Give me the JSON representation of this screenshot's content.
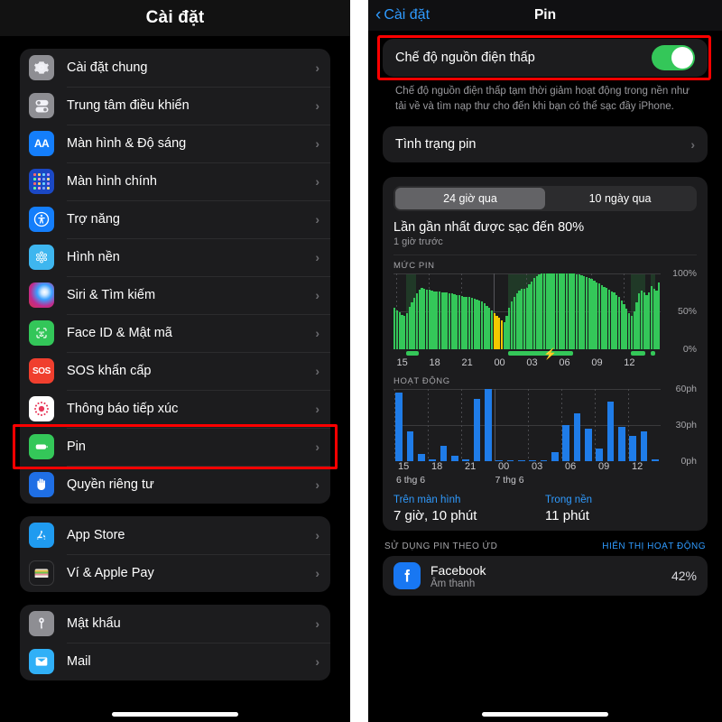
{
  "left": {
    "title": "Cài đặt",
    "groups": [
      {
        "items": [
          {
            "label": "Cài đặt chung",
            "icon": "gear-icon"
          },
          {
            "label": "Trung tâm điều khiển",
            "icon": "control-center-icon"
          },
          {
            "label": "Màn hình & Độ sáng",
            "icon": "display-brightness-icon"
          },
          {
            "label": "Màn hình chính",
            "icon": "home-screen-icon"
          },
          {
            "label": "Trợ năng",
            "icon": "accessibility-icon"
          },
          {
            "label": "Hình nền",
            "icon": "wallpaper-icon"
          },
          {
            "label": "Siri & Tìm kiếm",
            "icon": "siri-icon"
          },
          {
            "label": "Face ID & Mật mã",
            "icon": "face-id-icon"
          },
          {
            "label": "SOS khẩn cấp",
            "icon": "sos-icon"
          },
          {
            "label": "Thông báo tiếp xúc",
            "icon": "exposure-notification-icon"
          },
          {
            "label": "Pin",
            "icon": "battery-icon",
            "highlighted": true
          },
          {
            "label": "Quyền riêng tư",
            "icon": "privacy-hand-icon"
          }
        ]
      },
      {
        "items": [
          {
            "label": "App Store",
            "icon": "app-store-icon"
          },
          {
            "label": "Ví & Apple Pay",
            "icon": "wallet-icon"
          }
        ]
      },
      {
        "items": [
          {
            "label": "Mật khẩu",
            "icon": "key-icon"
          },
          {
            "label": "Mail",
            "icon": "mail-icon"
          }
        ]
      }
    ],
    "chevron": "›"
  },
  "right": {
    "back_label": "Cài đặt",
    "back_chevron": "‹",
    "title": "Pin",
    "low_power": {
      "label": "Chế độ nguồn điện thấp",
      "enabled": true,
      "footnote": "Chế độ nguồn điện thấp tạm thời giảm hoạt động trong nền như tải về và tìm nạp thư cho đến khi bạn có thể sạc đầy iPhone."
    },
    "battery_health": {
      "label": "Tình trạng pin",
      "chevron": "›"
    },
    "segmented": {
      "options": [
        "24 giờ qua",
        "10 ngày qua"
      ],
      "selected_index": 0
    },
    "last_charge": {
      "title": "Lần gần nhất được sạc đến 80%",
      "subtitle": "1 giờ trước"
    },
    "stats": [
      {
        "key": "Trên màn hình",
        "value": "7 giờ, 10 phút"
      },
      {
        "key": "Trong nền",
        "value": "11 phút"
      }
    ],
    "usage_section": {
      "left": "SỬ DỤNG PIN THEO ỨD",
      "right": "HIỂN THỊ HOẠT ĐỘNG"
    },
    "apps": [
      {
        "name": "Facebook",
        "sub": "Âm thanh",
        "pct": "42%",
        "icon": "facebook-icon",
        "color": "#1877f2"
      }
    ],
    "colors": {
      "accent_blue": "#2f9bff",
      "battery_green": "#34c759",
      "low_power_yellow": "#f5c800",
      "activity_blue": "#1f7ce8",
      "highlight_red": "#ff0000"
    }
  },
  "chart_data": [
    {
      "type": "bar",
      "title": "MỨC PIN",
      "xlabel": "",
      "ylabel": "",
      "ylim": [
        0,
        100
      ],
      "yticks": [
        0,
        50,
        100
      ],
      "ytick_labels": [
        "0%",
        "50%",
        "100%"
      ],
      "xticks": [
        "15",
        "18",
        "21",
        "00",
        "03",
        "06",
        "09",
        "12"
      ],
      "grid": true,
      "series_color": "#34c759",
      "lowpower_color": "#f5c800",
      "values": [
        55,
        52,
        49,
        46,
        44,
        48,
        56,
        62,
        68,
        74,
        79,
        81,
        80,
        79,
        79,
        78,
        77,
        77,
        77,
        76,
        76,
        75,
        74,
        74,
        73,
        72,
        72,
        71,
        70,
        70,
        69,
        68,
        67,
        66,
        65,
        63,
        61,
        58,
        55,
        52,
        48,
        45,
        42,
        39,
        36,
        45,
        55,
        63,
        70,
        74,
        78,
        80,
        80,
        81,
        86,
        90,
        94,
        97,
        99,
        100,
        100,
        100,
        100,
        100,
        100,
        100,
        100,
        100,
        100,
        100,
        100,
        100,
        100,
        99,
        99,
        98,
        97,
        96,
        95,
        93,
        91,
        89,
        87,
        85,
        83,
        81,
        79,
        77,
        75,
        72,
        69,
        65,
        60,
        54,
        48,
        44,
        50,
        62,
        74,
        78,
        75,
        72,
        76,
        84,
        80,
        78,
        88
      ],
      "lowpower_bar_indices": [
        40,
        41,
        42,
        43
      ],
      "charging_shaded_ranges": [
        [
          5,
          9
        ],
        [
          46,
          64
        ],
        [
          95,
          101
        ],
        [
          103,
          105
        ]
      ],
      "charging_segments": [
        [
          5,
          10
        ],
        [
          46,
          72
        ],
        [
          95,
          101
        ],
        [
          103,
          105
        ]
      ],
      "bolt_at_index": 60
    },
    {
      "type": "bar",
      "title": "HOẠT ĐỘNG",
      "xlabel": "",
      "ylabel": "",
      "ylim": [
        0,
        60
      ],
      "yticks": [
        0,
        30,
        60
      ],
      "ytick_labels": [
        "0ph",
        "30ph",
        "60ph"
      ],
      "xticks": [
        "15",
        "18",
        "21",
        "00",
        "03",
        "06",
        "09",
        "12"
      ],
      "day_labels": [
        "6 thg 6",
        "7 thg 6"
      ],
      "grid": true,
      "series_color": "#1f7ce8",
      "values": [
        57,
        25,
        6,
        1,
        13,
        5,
        2,
        52,
        60,
        0,
        0,
        0,
        0,
        0,
        8,
        30,
        40,
        27,
        11,
        50,
        29,
        21,
        25,
        1
      ]
    }
  ]
}
